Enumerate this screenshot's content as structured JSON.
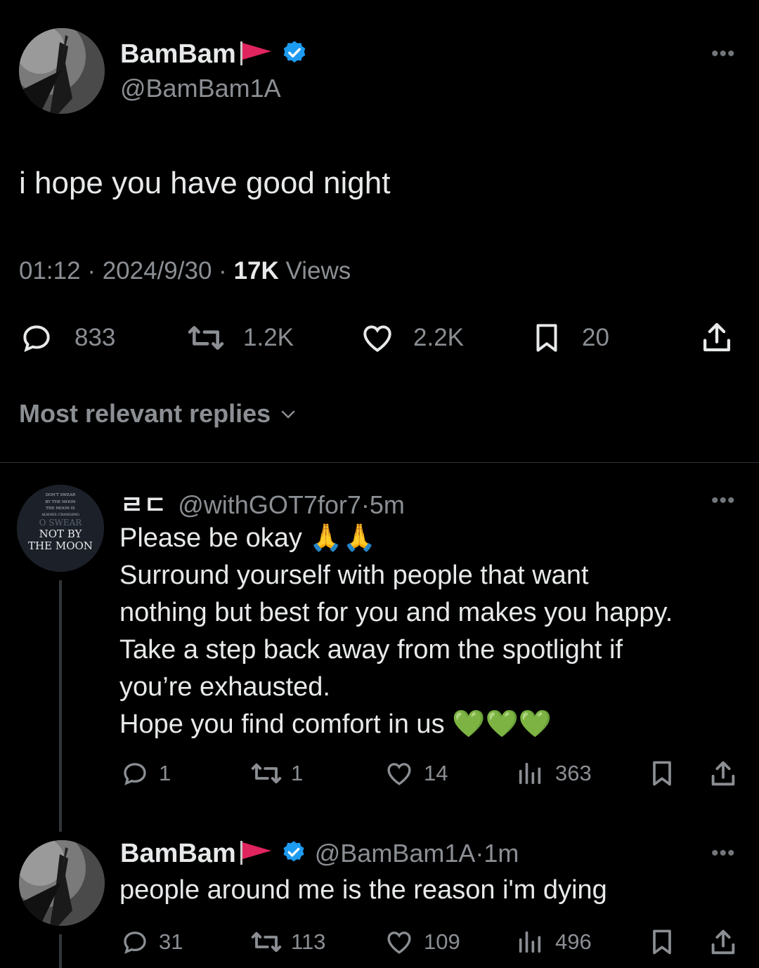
{
  "main_tweet": {
    "display_name": "BamBam",
    "handle": "@BamBam1A",
    "text": "i hope you have good night",
    "time": "01:12",
    "date": "2024/9/30",
    "views_count": "17K",
    "views_label": "Views",
    "separator": "·",
    "actions": {
      "replies": "833",
      "retweets": "1.2K",
      "likes": "2.2K",
      "bookmarks": "20"
    }
  },
  "replies_sort": {
    "label": "Most relevant replies"
  },
  "reply_1": {
    "display_name": "ㄹㄷ",
    "handle": "@withGOT7for7",
    "time": "5m",
    "separator": "·",
    "lines": [
      "Please be okay 🙏🙏",
      "Surround yourself with people that want",
      "nothing but best for you and makes you happy.",
      "Take a step back away from the spotlight if",
      "you’re exhausted.",
      "Hope you find comfort in us 💚💚💚"
    ],
    "avatar_text": [
      "DON'T SWEAR",
      "BY THE MOON",
      "THE MOON IS",
      "ALWAYS CHANGING",
      "O SWEAR",
      "NOT BY",
      "THE MOON"
    ],
    "actions": {
      "replies": "1",
      "retweets": "1",
      "likes": "14",
      "views": "363"
    }
  },
  "reply_2": {
    "display_name": "BamBam",
    "handle": "@BamBam1A",
    "time": "1m",
    "separator": "·",
    "text": "people around me is the reason i'm dying",
    "actions": {
      "replies": "31",
      "retweets": "113",
      "likes": "109",
      "views": "496"
    }
  },
  "colors": {
    "background": "#000000",
    "text": "#e7e9ea",
    "muted": "#8b8f94",
    "verified": "#1d9bf0",
    "flag": "#e0245e"
  },
  "icons": [
    "more-icon",
    "verified-badge-icon",
    "red-flag-icon",
    "reply-icon",
    "retweet-icon",
    "like-icon",
    "bookmark-icon",
    "share-icon",
    "views-icon",
    "chevron-down-icon"
  ]
}
